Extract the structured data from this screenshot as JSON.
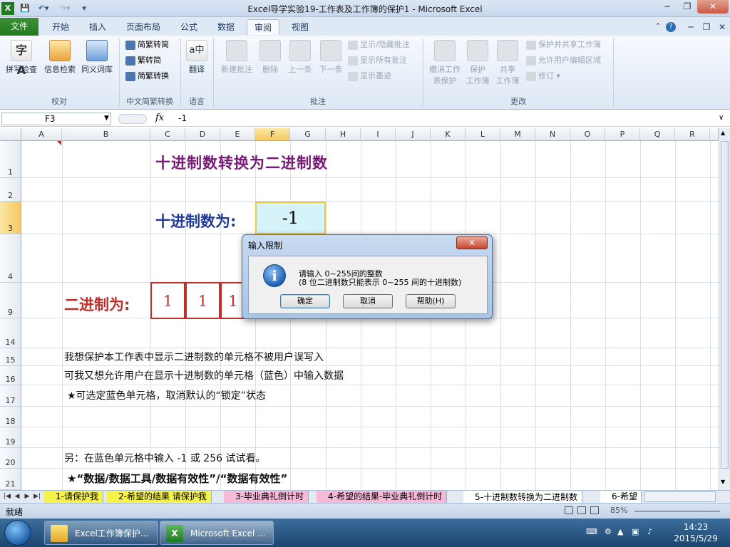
{
  "window": {
    "title": "Excel导学实验19-工作表及工作簿的保护1 - Microsoft Excel"
  },
  "qat": {
    "save_icon": "save-icon",
    "undo_icon": "undo-icon",
    "redo_icon": "redo-icon"
  },
  "ribbon_tabs": [
    "文件",
    "开始",
    "插入",
    "页面布局",
    "公式",
    "数据",
    "审阅",
    "视图"
  ],
  "ribbon": {
    "proofing": {
      "spell": "拼写检查",
      "research": "信息检索",
      "thesaurus": "同义词库",
      "group": "校对"
    },
    "chinese": {
      "to_trad": "简繁转简",
      "to_simp": "繁转简",
      "conv": "简繁转换",
      "group": "中文简繁转换"
    },
    "language": {
      "translate": "翻译",
      "group": "语言"
    },
    "comments": {
      "new": "新建批注",
      "delete": "删除",
      "prev": "上一条",
      "next": "下一条",
      "show_hide": "显示/隐藏批注",
      "show_all": "显示所有批注",
      "show_ink": "显示墨迹",
      "group": "批注"
    },
    "changes": {
      "unprotect_1": "撤消工作",
      "unprotect_2": "表保护",
      "protect_wb_1": "保护",
      "protect_wb_2": "工作簿",
      "share_1": "共享",
      "share_2": "工作簿",
      "protect_share": "保护并共享工作簿",
      "allow_edit": "允许用户编辑区域",
      "track": "修订",
      "group": "更改"
    }
  },
  "formula_bar": {
    "name_box": "F3",
    "fx": "fx",
    "formula": "-1"
  },
  "columns": [
    "A",
    "B",
    "C",
    "D",
    "E",
    "F",
    "G",
    "H",
    "I",
    "J",
    "K",
    "L",
    "M",
    "N",
    "O",
    "P",
    "Q",
    "R"
  ],
  "rows": [
    "1",
    "2",
    "3",
    "4",
    "9",
    "14",
    "15",
    "16",
    "17",
    "18",
    "19",
    "20",
    "21"
  ],
  "sheet": {
    "title": "十进制数转换为二进制数",
    "decimal_label": "十进制数为:",
    "decimal_value": "-1",
    "binary_label": "二进制为:",
    "binary_digits": [
      "1",
      "1",
      "1"
    ],
    "notes": [
      "我想保护本工作表中显示二进制数的单元格不被用户误写入",
      "可我又想允许用户在显示十进制数的单元格（蓝色）中输入数据",
      "★可选定蓝色单元格，取消默认的“锁定”状态",
      "另：在蓝色单元格中输入 -1 或 256 试试看。",
      "★“数据/数据工具/数据有效性”/“数据有效性”"
    ]
  },
  "dialog": {
    "title": "输入限制",
    "message_line1": "请输入 0~255间的整数",
    "message_line2": "(8 位二进制数只能表示 0~255 间的十进制数)",
    "ok": "确定",
    "cancel": "取消",
    "help": "帮助(H)"
  },
  "sheet_tabs": [
    {
      "label": "1-请保护我",
      "color": "#f7f24a"
    },
    {
      "label": "2-希望的结果 请保护我",
      "color": "#f7f24a"
    },
    {
      "label": "3-毕业典礼倒计时",
      "color": "#f7b9d8"
    },
    {
      "label": "4-希望的结果-毕业典礼倒计时",
      "color": "#f7b9d8"
    },
    {
      "label": "5-十进制数转换为二进制数",
      "color": "#ffffff"
    },
    {
      "label": "6-希望",
      "color": "#ffffff"
    }
  ],
  "status": {
    "ready": "就绪",
    "zoom": "85%"
  },
  "taskbar": {
    "items": [
      {
        "label": "Excel工作簿保护...",
        "icon": "folder-icon"
      },
      {
        "label": "Microsoft Excel ...",
        "icon": "excel-icon"
      }
    ],
    "time": "14:23",
    "date": "2015/5/29"
  },
  "colors": {
    "accent_green": "#217a1d",
    "title_purple": "#7a1a78",
    "label_blue": "#1f3a9a",
    "binary_red": "#c0302a",
    "input_cell": "#d6f3fa"
  }
}
